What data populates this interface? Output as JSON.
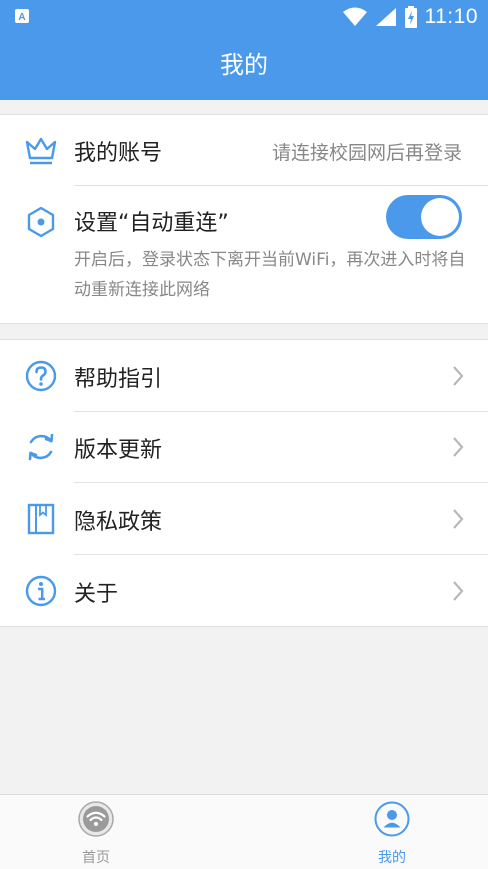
{
  "status_bar": {
    "time": "11:10",
    "left_icon": "app-notification-icon",
    "icons": [
      "wifi-icon",
      "signal-icon",
      "battery-charging-icon"
    ]
  },
  "header": {
    "title": "我的"
  },
  "account_group": {
    "account": {
      "icon": "crown-icon",
      "label": "我的账号",
      "value": "请连接校园网后再登录"
    },
    "auto_reconnect": {
      "icon": "hexagon-icon",
      "label": "设置“自动重连”",
      "enabled": true,
      "description": "开启后，登录状态下离开当前WiFi，再次进入时将自动重新连接此网络"
    }
  },
  "menu": [
    {
      "icon": "question-circle-icon",
      "label": "帮助指引"
    },
    {
      "icon": "refresh-icon",
      "label": "版本更新"
    },
    {
      "icon": "book-icon",
      "label": "隐私政策"
    },
    {
      "icon": "info-circle-icon",
      "label": "关于"
    }
  ],
  "tabs": [
    {
      "label": "首页",
      "icon": "wifi-home-icon",
      "active": false
    },
    {
      "label": "我的",
      "icon": "user-profile-icon",
      "active": true
    }
  ],
  "colors": {
    "primary": "#4a99ea",
    "background": "#f2f2f2",
    "inactive_tab": "#999999"
  }
}
